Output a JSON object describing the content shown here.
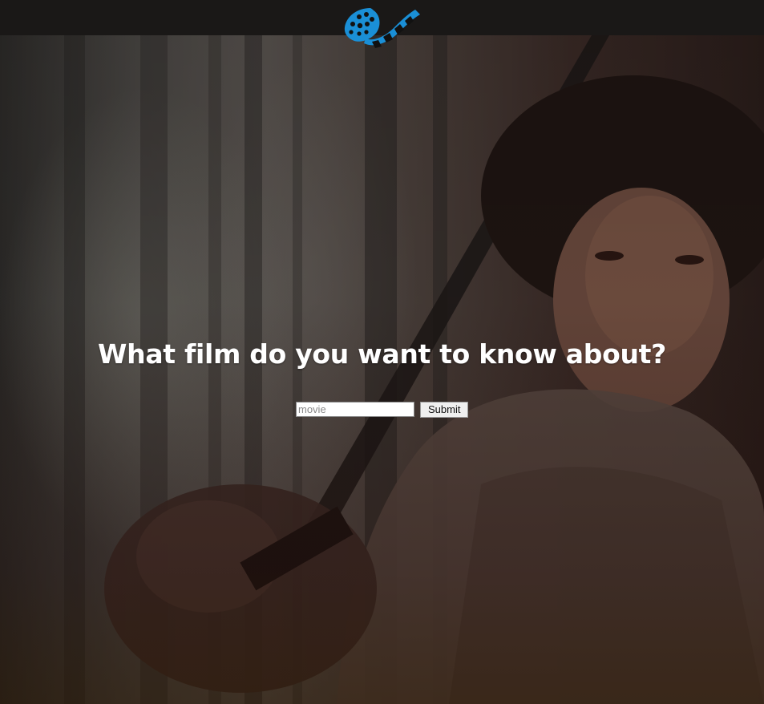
{
  "header": {
    "logo_icon": "film-reel-logo-icon",
    "accent_color": "#1a8fd6"
  },
  "hero": {
    "headline": "What film do you want to know about?"
  },
  "search": {
    "placeholder": "movie",
    "value": "",
    "submit_label": "Submit"
  }
}
